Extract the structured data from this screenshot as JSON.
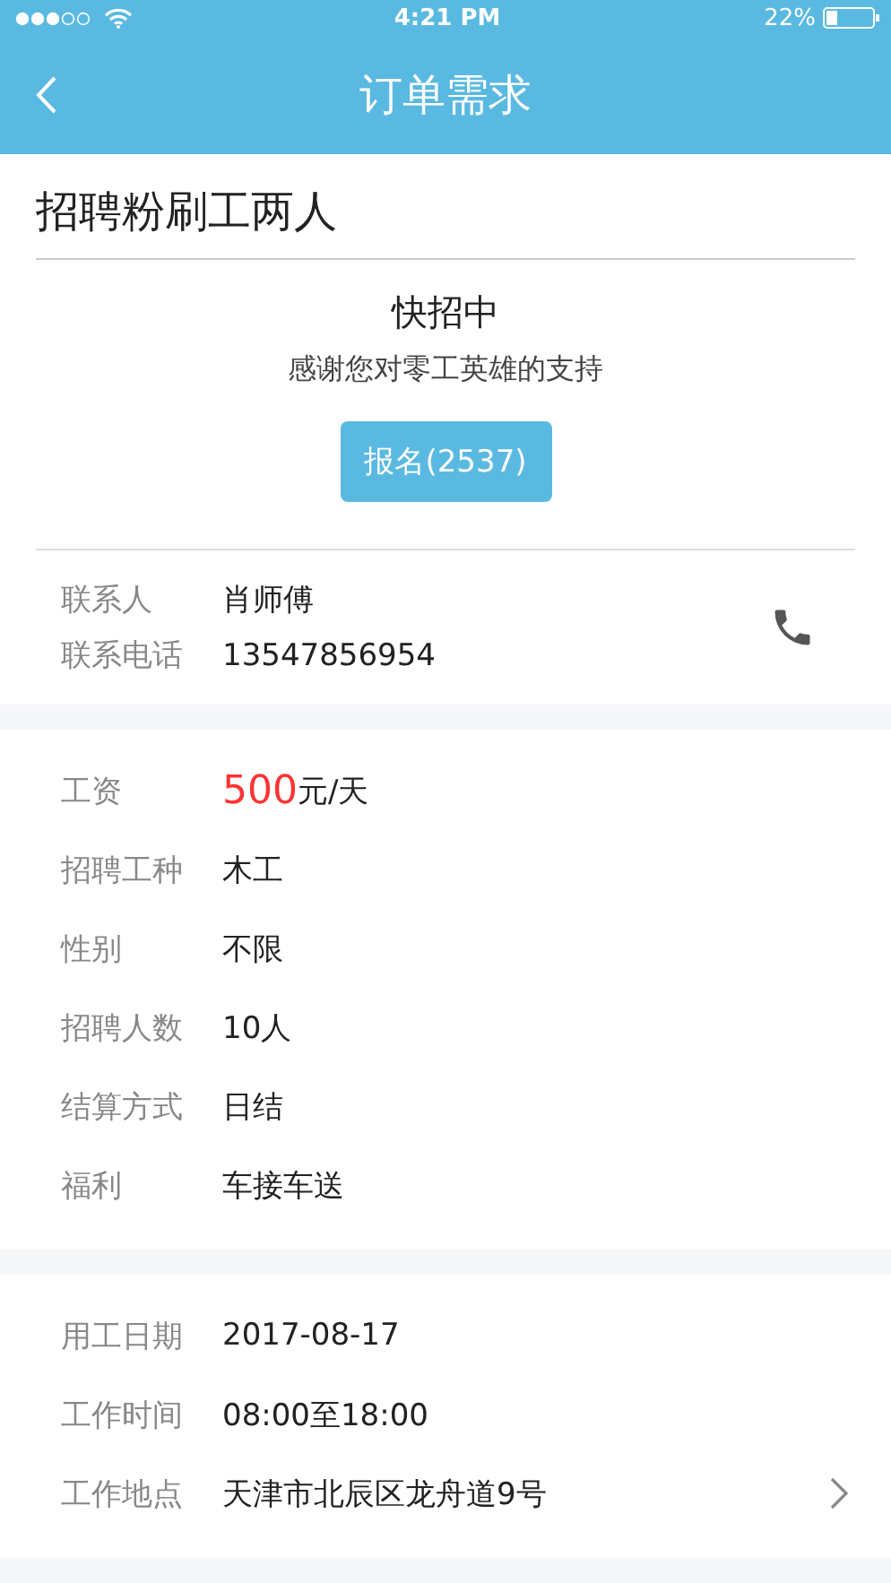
{
  "status_bar": {
    "time": "4:21 PM",
    "battery_text": "22%"
  },
  "nav": {
    "title": "订单需求"
  },
  "order": {
    "title": "招聘粉刷工两人",
    "status": "快招中",
    "subtitle": "感谢您对零工英雄的支持",
    "signup_button": "报名(2537)"
  },
  "contact": [
    {
      "label": "联系人",
      "value": "肖师傅"
    },
    {
      "label": "联系电话",
      "value": "13547856954"
    }
  ],
  "details": [
    {
      "kind": "salary",
      "label": "工资",
      "amount": "500",
      "unit": "元/天"
    },
    {
      "kind": "text",
      "label": "招聘工种",
      "value": "木工"
    },
    {
      "kind": "text",
      "label": "性别",
      "value": "不限"
    },
    {
      "kind": "text",
      "label": "招聘人数",
      "value": "10人"
    },
    {
      "kind": "text",
      "label": "结算方式",
      "value": "日结"
    },
    {
      "kind": "text",
      "label": "福利",
      "value": "车接车送"
    }
  ],
  "schedule": [
    {
      "label": "用工日期",
      "value": "2017-08-17",
      "link": false
    },
    {
      "label": "工作时间",
      "value": "08:00至18:00",
      "link": false
    },
    {
      "label": "工作地点",
      "value": "天津市北辰区龙舟道9号",
      "link": true
    }
  ]
}
